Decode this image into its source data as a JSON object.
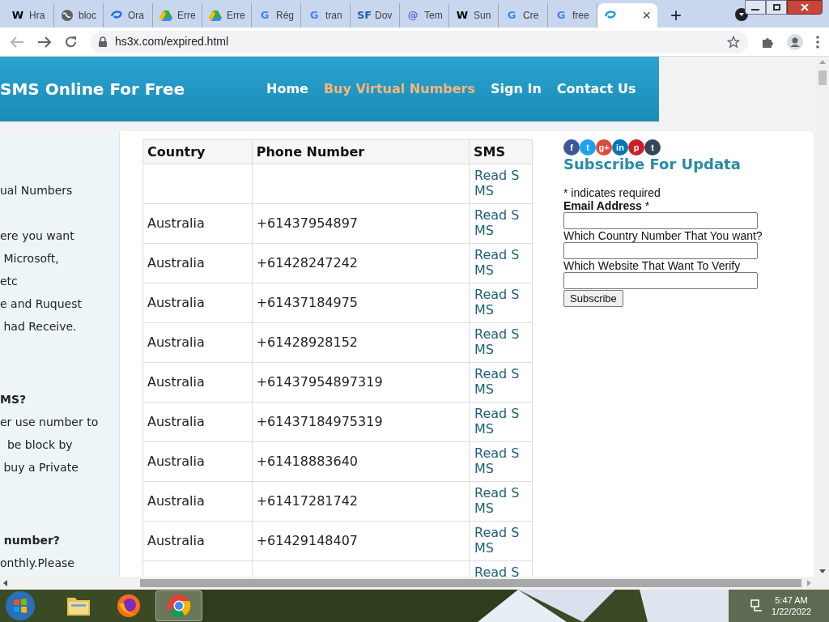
{
  "browser": {
    "tabs": [
      {
        "favicon": {
          "kind": "letter",
          "glyph": "W",
          "color": "#000000"
        },
        "label": "Hra",
        "selected": false
      },
      {
        "favicon": {
          "kind": "globe",
          "color": "#5f6368"
        },
        "label": "bloc",
        "selected": false
      },
      {
        "favicon": {
          "kind": "swirl",
          "color": "#1a73e8"
        },
        "label": "Ora",
        "selected": false
      },
      {
        "favicon": {
          "kind": "triangle",
          "color": "#34a853"
        },
        "label": "Erre",
        "selected": false
      },
      {
        "favicon": {
          "kind": "triangle",
          "color": "#34a853"
        },
        "label": "Erre",
        "selected": false
      },
      {
        "favicon": {
          "kind": "letter",
          "glyph": "G",
          "color": "#4285f4"
        },
        "label": "Rég",
        "selected": false
      },
      {
        "favicon": {
          "kind": "letter",
          "glyph": "G",
          "color": "#4285f4"
        },
        "label": "tran",
        "selected": false
      },
      {
        "favicon": {
          "kind": "letter",
          "glyph": "SF",
          "color": "#1f5fa8"
        },
        "label": "Dov",
        "selected": false
      },
      {
        "favicon": {
          "kind": "letter",
          "glyph": "@",
          "color": "#5b6ee1"
        },
        "label": "Tem",
        "selected": false
      },
      {
        "favicon": {
          "kind": "letter",
          "glyph": "W",
          "color": "#000000"
        },
        "label": "Sun",
        "selected": false
      },
      {
        "favicon": {
          "kind": "letter",
          "glyph": "G",
          "color": "#4285f4"
        },
        "label": "Cre",
        "selected": false
      },
      {
        "favicon": {
          "kind": "letter",
          "glyph": "G",
          "color": "#4285f4"
        },
        "label": "free",
        "selected": false
      },
      {
        "favicon": {
          "kind": "swirl",
          "color": "#1aa3d9"
        },
        "close": "×",
        "selected": true
      }
    ],
    "new_tab": "+",
    "url": "hs3x.com/expired.html"
  },
  "site": {
    "title": "SMS Online For Free",
    "nav": [
      {
        "label": "Home",
        "selected": false
      },
      {
        "label": "Buy Virtual Numbers",
        "selected": true
      },
      {
        "label": "Sign In",
        "selected": false
      },
      {
        "label": "Contact Us",
        "selected": false
      }
    ],
    "sidebar": [
      {
        "kind": "text",
        "lines": [
          "ual Numbers"
        ]
      },
      {
        "kind": "text",
        "lines": [
          "ere you want",
          " Microsoft,",
          "etc",
          "e and Ruquest",
          " had Receive."
        ]
      },
      {
        "kind": "heading",
        "lines": [
          "MS?"
        ]
      },
      {
        "kind": "text",
        "lines": [
          "er use number to",
          "  be block by",
          " buy a Private"
        ]
      },
      {
        "kind": "heading",
        "lines": [
          " number?"
        ]
      },
      {
        "kind": "text",
        "lines": [
          "onthly.Please"
        ]
      }
    ],
    "table": {
      "columns": [
        "Country",
        "Phone Number",
        "SMS"
      ],
      "rows": [
        {
          "country": "",
          "phone": "",
          "sms": "Read SMS"
        },
        {
          "country": "Australia",
          "phone": "+61437954897",
          "sms": "Read SMS"
        },
        {
          "country": "Australia",
          "phone": "+61428247242",
          "sms": "Read SMS"
        },
        {
          "country": "Australia",
          "phone": "+61437184975",
          "sms": "Read SMS"
        },
        {
          "country": "Australia",
          "phone": "+61428928152",
          "sms": "Read SMS"
        },
        {
          "country": "Australia",
          "phone": "+61437954897319",
          "sms": "Read SMS"
        },
        {
          "country": "Australia",
          "phone": "+61437184975319",
          "sms": "Read SMS"
        },
        {
          "country": "Australia",
          "phone": "+61418883640",
          "sms": "Read SMS"
        },
        {
          "country": "Australia",
          "phone": "+61417281742",
          "sms": "Read SMS"
        },
        {
          "country": "Australia",
          "phone": "+61429148407",
          "sms": "Read SMS"
        },
        {
          "country": "",
          "phone": "",
          "sms": "Read S"
        }
      ]
    },
    "social": [
      {
        "glyph": "f",
        "color": "#3b5998"
      },
      {
        "glyph": "t",
        "color": "#1da1f2"
      },
      {
        "glyph": "g+",
        "color": "#dd4b39"
      },
      {
        "glyph": "in",
        "color": "#0077b5"
      },
      {
        "glyph": "p",
        "color": "#cb2027"
      },
      {
        "glyph": "t",
        "color": "#35465c"
      }
    ],
    "subscribe": {
      "title": "Subscribe For Updata",
      "required_note": "* indicates required",
      "fields": [
        {
          "label": "Email Address",
          "required_mark": "*",
          "bold": true
        },
        {
          "label": "Which Country Number That You want?",
          "bold": false
        },
        {
          "label": "Which Website That Want To Verify",
          "bold": false
        }
      ],
      "button": "Subscribe"
    }
  },
  "taskbar": {
    "apps": [
      {
        "kind": "folder",
        "selected": false
      },
      {
        "kind": "firefox",
        "selected": false
      },
      {
        "kind": "chrome",
        "selected": true
      }
    ],
    "time": "5:47 AM",
    "date": "1/22/2022"
  }
}
